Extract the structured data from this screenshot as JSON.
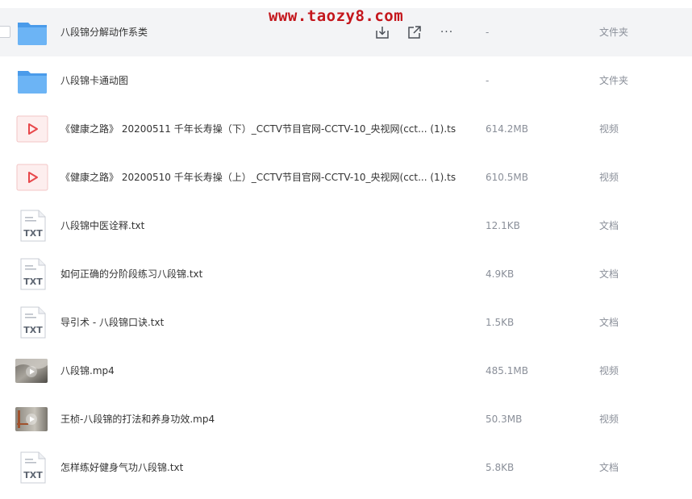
{
  "watermark": "www.taozy8.com",
  "files": [
    {
      "name": "八段锦分解动作系类",
      "size": "-",
      "type": "文件夹",
      "icon": "folder-icon"
    },
    {
      "name": "八段锦卡通动图",
      "size": "-",
      "type": "文件夹",
      "icon": "folder-icon"
    },
    {
      "name": "《健康之路》 20200511 千年长寿操（下）_CCTV节目官网-CCTV-10_央视网(cct... (1).ts",
      "size": "614.2MB",
      "type": "视频",
      "icon": "video-icon"
    },
    {
      "name": "《健康之路》 20200510 千年长寿操（上）_CCTV节目官网-CCTV-10_央视网(cct... (1).ts",
      "size": "610.5MB",
      "type": "视频",
      "icon": "video-icon"
    },
    {
      "name": "八段锦中医诠释.txt",
      "size": "12.1KB",
      "type": "文档",
      "icon": "txt-icon"
    },
    {
      "name": "如何正确的分阶段练习八段锦.txt",
      "size": "4.9KB",
      "type": "文档",
      "icon": "txt-icon"
    },
    {
      "name": "导引术 - 八段锦口诀.txt",
      "size": "1.5KB",
      "type": "文档",
      "icon": "txt-icon"
    },
    {
      "name": "八段锦.mp4",
      "size": "485.1MB",
      "type": "视频",
      "icon": "mp4-thumbnail-icon"
    },
    {
      "name": "王桢-八段锦的打法和养身功效.mp4",
      "size": "50.3MB",
      "type": "视频",
      "icon": "mp4-thumbnail-icon"
    },
    {
      "name": "怎样练好健身气功八段锦.txt",
      "size": "5.8KB",
      "type": "文档",
      "icon": "txt-icon"
    }
  ],
  "row_actions": {
    "download_icon": "download-icon",
    "share_icon": "share-icon",
    "more_label": "···"
  },
  "colors": {
    "watermark": "#c4161c",
    "folder": "#5ea9f2",
    "video_play": "#e8484b",
    "hover_row": "#f3f4f6",
    "muted_text": "#8a8f99"
  }
}
